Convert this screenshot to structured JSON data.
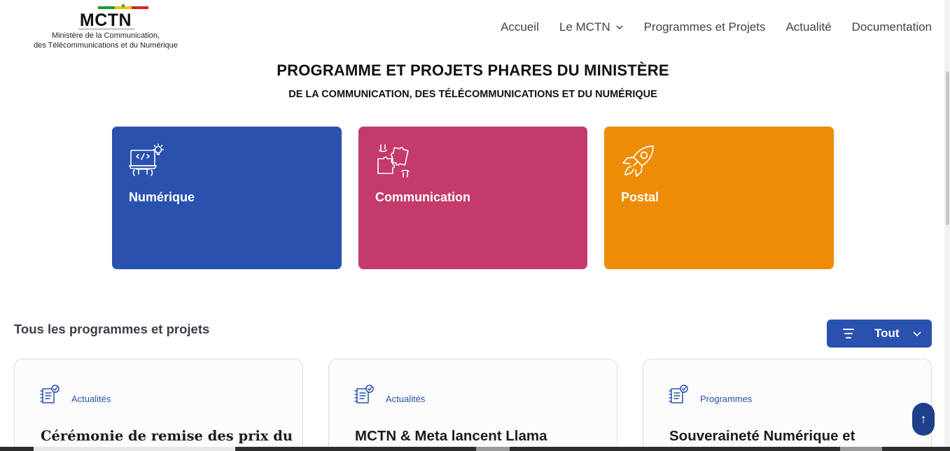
{
  "header": {
    "logo": {
      "mark": "MCTN",
      "subtitle_line1": "Ministère de la Communication,",
      "subtitle_line2": "des Télécommunications et du Numérique",
      "flag_colors": [
        "#1a9b3c",
        "#f2c20e",
        "#d4242c"
      ]
    },
    "nav": [
      {
        "label": "Accueil"
      },
      {
        "label": "Le MCTN",
        "icon": "chevron-down-icon"
      },
      {
        "label": "Programmes et Projets"
      },
      {
        "label": "Actualité"
      },
      {
        "label": "Documentation"
      }
    ]
  },
  "hero": {
    "title": "PROGRAMME ET PROJETS PHARES DU MINISTÈRE",
    "subtitle": "DE LA COMMUNICATION, DES TÉLÉCOMMUNICATIONS ET DU NUMÉRIQUE"
  },
  "categories": [
    {
      "label": "Numérique",
      "icon": "laptop-code-icon",
      "color": "#2852ae"
    },
    {
      "label": "Communication",
      "icon": "puzzle-handshake-icon",
      "color": "#c43a6c"
    },
    {
      "label": "Postal",
      "icon": "rocket-icon",
      "color": "#ee8c05"
    }
  ],
  "section": {
    "title": "Tous les programmes et projets",
    "filter": {
      "label": "Tout",
      "icon": "filter-lines-icon",
      "chevron": "chevron-down-icon"
    }
  },
  "projects": [
    {
      "category": "Actualités",
      "title": "Cérémonie de remise des prix du",
      "icon": "document-check-icon"
    },
    {
      "category": "Actualités",
      "title": "MCTN & Meta lancent Llama",
      "icon": "document-check-icon"
    },
    {
      "category": "Programmes",
      "title": "Souveraineté Numérique et",
      "icon": "document-check-icon"
    }
  ],
  "back_to_top": {
    "label": "↑",
    "icon": "arrow-up-icon"
  },
  "colors": {
    "primary": "#2852ae",
    "communication": "#c43a6c",
    "postal": "#ee8c05"
  }
}
